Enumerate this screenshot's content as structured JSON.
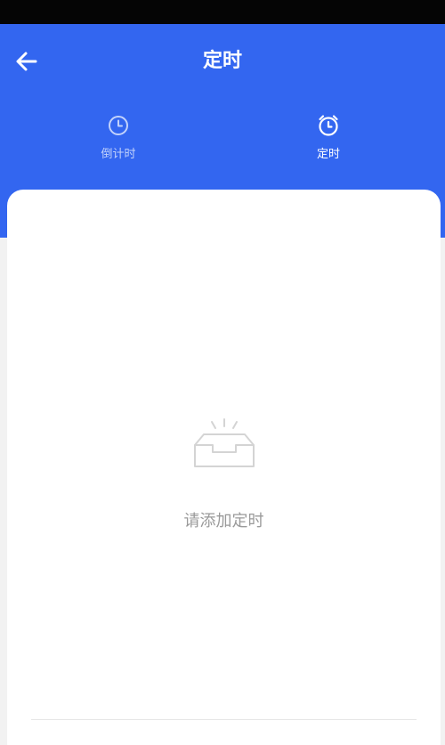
{
  "header": {
    "title": "定时",
    "back_icon": "arrow-left-icon"
  },
  "tabs": [
    {
      "label": "倒计时",
      "icon": "clock-icon",
      "active": false
    },
    {
      "label": "定时",
      "icon": "alarm-clock-icon",
      "active": true
    }
  ],
  "empty_state": {
    "icon": "empty-inbox-icon",
    "text": "请添加定时"
  },
  "colors": {
    "primary": "#3366f0",
    "status_bar": "#050505",
    "background": "#f2f2f2",
    "card": "#ffffff",
    "muted_text": "#9a9a9a"
  }
}
